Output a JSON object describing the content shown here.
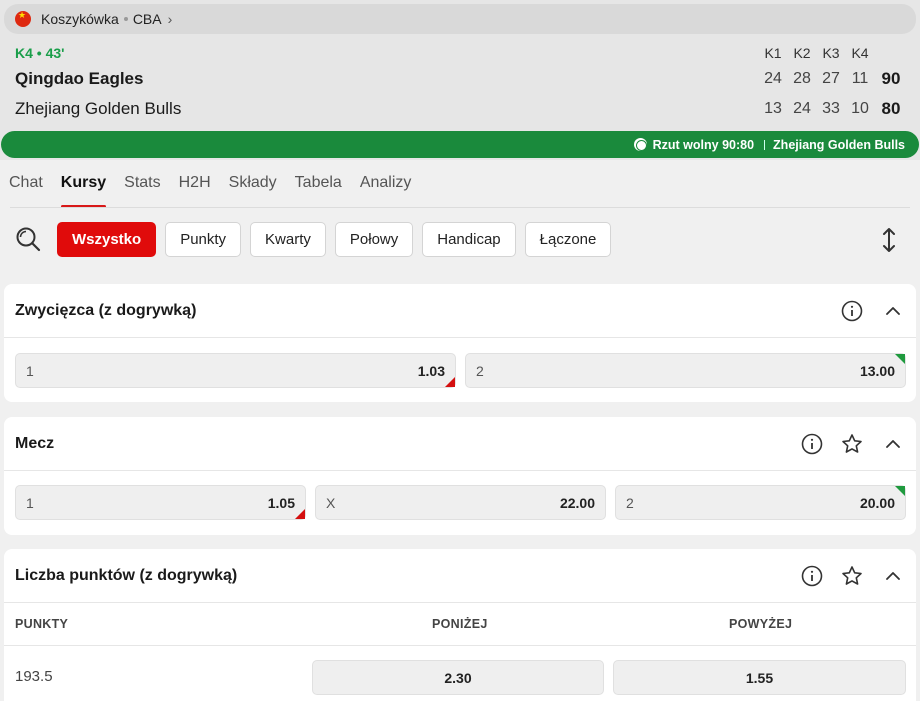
{
  "breadcrumb": {
    "sport": "Koszykówka",
    "league": "CBA"
  },
  "match": {
    "status": "K4 • 43'",
    "quarters": [
      "K1",
      "K2",
      "K3",
      "K4"
    ],
    "teams": [
      {
        "name": "Qingdao Eagles",
        "scores": [
          "24",
          "28",
          "27",
          "11"
        ],
        "total": "90"
      },
      {
        "name": "Zhejiang Golden Bulls",
        "scores": [
          "13",
          "24",
          "33",
          "10"
        ],
        "total": "80"
      }
    ]
  },
  "ticker": {
    "event": "Rzut wolny 90:80",
    "team": "Zhejiang Golden Bulls"
  },
  "tabs": [
    "Chat",
    "Kursy",
    "Stats",
    "H2H",
    "Składy",
    "Tabela",
    "Analizy"
  ],
  "active_tab": "Kursy",
  "filters": [
    "Wszystko",
    "Punkty",
    "Kwarty",
    "Połowy",
    "Handicap",
    "Łączone"
  ],
  "markets": {
    "winner": {
      "title": "Zwycięzca (z dogrywką)",
      "outcomes": [
        {
          "label": "1",
          "odds": "1.03",
          "trend": "down"
        },
        {
          "label": "2",
          "odds": "13.00",
          "trend": "up"
        }
      ]
    },
    "match": {
      "title": "Mecz",
      "outcomes": [
        {
          "label": "1",
          "odds": "1.05",
          "trend": "down"
        },
        {
          "label": "X",
          "odds": "22.00",
          "trend": "none"
        },
        {
          "label": "2",
          "odds": "20.00",
          "trend": "up"
        }
      ]
    },
    "points": {
      "title": "Liczba punktów (z dogrywką)",
      "headers": [
        "PUNKTY",
        "PONIŻEJ",
        "POWYŻEJ"
      ],
      "rows": [
        {
          "line": "193.5",
          "under": "2.30",
          "over": "1.55"
        }
      ]
    }
  },
  "colors": {
    "accent": "#e00b0b",
    "live_green": "#1a8a3c",
    "up": "#1f9a3e",
    "down": "#d40f0f"
  },
  "icons": [
    "china-flag-icon",
    "chevron-right-icon",
    "basketball-icon",
    "search-icon",
    "sort-arrows-icon",
    "info-icon",
    "star-icon",
    "chevron-up-icon"
  ]
}
